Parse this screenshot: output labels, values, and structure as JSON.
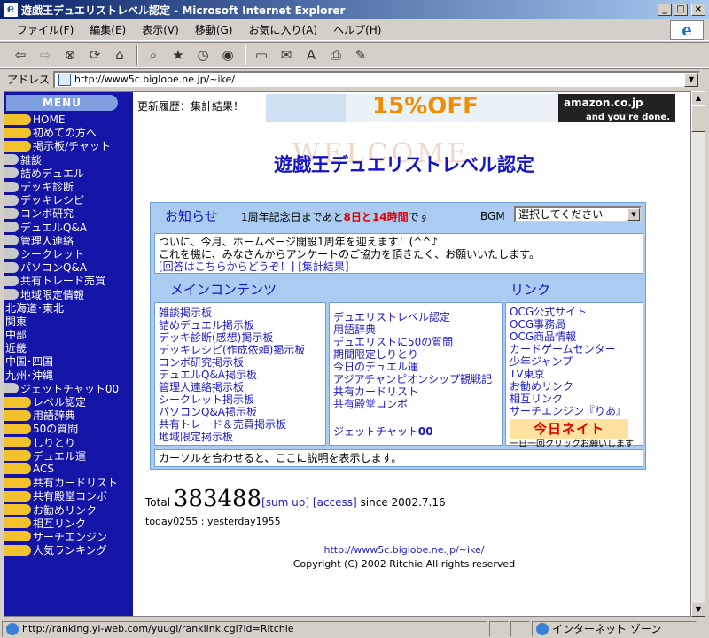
{
  "window": {
    "title": "遊戯王デュエリストレベル認定 - Microsoft Internet Explorer",
    "min": "_",
    "max": "□",
    "close": "×"
  },
  "menubar": [
    "ファイル(F)",
    "編集(E)",
    "表示(V)",
    "移動(G)",
    "お気に入り(A)",
    "ヘルプ(H)"
  ],
  "address": {
    "label": "アドレス",
    "url": "http://www5c.biglobe.ne.jp/~ike/"
  },
  "sidebar": {
    "menu_label": "MENU",
    "items": [
      {
        "label": "HOME",
        "pill": "yellow"
      },
      {
        "label": "初めての方へ",
        "pill": "yellow"
      },
      {
        "label": "掲示板/チャット",
        "pill": "yellow"
      },
      {
        "label": "雑談",
        "pill": "gray"
      },
      {
        "label": "詰めデュエル",
        "pill": "gray"
      },
      {
        "label": "デッキ診断",
        "pill": "gray"
      },
      {
        "label": "デッキレシピ",
        "pill": "gray"
      },
      {
        "label": "コンボ研究",
        "pill": "gray"
      },
      {
        "label": "デュエルQ&A",
        "pill": "gray"
      },
      {
        "label": "管理人連絡",
        "pill": "gray"
      },
      {
        "label": "シークレット",
        "pill": "gray"
      },
      {
        "label": "パソコンQ&A",
        "pill": "gray"
      },
      {
        "label": "共有トレード売買",
        "pill": "gray"
      },
      {
        "label": "地域限定情報",
        "pill": "gray"
      },
      {
        "label": "北海道･東北",
        "pill": "none"
      },
      {
        "label": "関東",
        "pill": "none"
      },
      {
        "label": "中部",
        "pill": "none"
      },
      {
        "label": "近畿",
        "pill": "none"
      },
      {
        "label": "中国･四国",
        "pill": "none"
      },
      {
        "label": "九州･沖縄",
        "pill": "none"
      },
      {
        "label": "ジェットチャット00",
        "pill": "gray"
      },
      {
        "label": "レベル認定",
        "pill": "yellow"
      },
      {
        "label": "用語辞典",
        "pill": "yellow"
      },
      {
        "label": "50の質問",
        "pill": "yellow"
      },
      {
        "label": "しりとり",
        "pill": "yellow"
      },
      {
        "label": "デュエル運",
        "pill": "yellow"
      },
      {
        "label": "ACS",
        "pill": "yellow"
      },
      {
        "label": "共有カードリスト",
        "pill": "yellow"
      },
      {
        "label": "共有殿堂コンボ",
        "pill": "yellow"
      },
      {
        "label": "お勧めリンク",
        "pill": "yellow"
      },
      {
        "label": "相互リンク",
        "pill": "yellow"
      },
      {
        "label": "サーチエンジン",
        "pill": "yellow"
      },
      {
        "label": "人気ランキング",
        "pill": "yellow"
      }
    ]
  },
  "main": {
    "update": "更新履歴：集計結果！",
    "ad": {
      "big": "15%OFF",
      "domain": "amazon.co.jp",
      "tag": "and you're done."
    },
    "watermark": "WELCOME",
    "site_title": "遊戯王デュエリストレベル認定",
    "notice_label": "お知らせ",
    "countdown_prefix": "1周年記念日まであと",
    "countdown_days": "8日と14時間",
    "countdown_suffix": "です",
    "bgm_label": "BGM",
    "bgm_select": "選択してください",
    "notice_line1": "ついに、今月、ホームページ開設1周年を迎えます！(^^♪",
    "notice_line2": "これを機に、みなさんからアンケートのご協力を頂きたく、お願いいたします。",
    "notice_link1": "[回答はこちらからどうぞ！]",
    "notice_link2": "[集計結果]",
    "main_contents_label": "メインコンテンツ",
    "links_label": "リンク",
    "col1": [
      "雑談掲示板",
      "詰めデュエル掲示板",
      "デッキ診断(感想)掲示板",
      "デッキレシピ(作成依頼)掲示板",
      "コンボ研究掲示板",
      "デュエルQ&A掲示板",
      "管理人連絡掲示板",
      "シークレット掲示板",
      "パソコンQ&A掲示板",
      "共有トレード＆売買掲示板",
      "地域限定掲示板"
    ],
    "col2": [
      "デュエリストレベル認定",
      "用語辞典",
      "デュエリストに50の質問",
      "期間限定しりとり",
      "今日のデュエル運",
      "アジアチャンピオンシップ観戦記",
      "共有カードリスト",
      "共有殿堂コンボ"
    ],
    "jet_chat": "ジェットチャット",
    "jet_zero": "00",
    "col3": [
      "OCG公式サイト",
      "OCG事務局",
      "OCG商品情報",
      "カードゲームセンター",
      "少年ジャンプ",
      "TV東京",
      "お勧めリンク",
      "相互リンク",
      "サーチエンジン『りあ』"
    ],
    "ranking_logo": "今日ネイト",
    "ranking_note": "一日一回クリックお願いします",
    "desc_text": "カーソルを合わせると、ここに説明を表示します。",
    "total_label": "Total",
    "total_digits": "383488",
    "sum_up": "[sum up]",
    "access": "[access]",
    "since": "since 2002.7.16",
    "today_line": "today0255 : yesterday1955",
    "footer_url": "http://www5c.biglobe.ne.jp/~ike/",
    "copyright": "Copyright (C) 2002 Ritchie All rights reserved"
  },
  "status": {
    "url": "http://ranking.yi-web.com/yuugi/ranklink.cgi?id=Ritchie",
    "zone": "インターネット ゾーン"
  }
}
